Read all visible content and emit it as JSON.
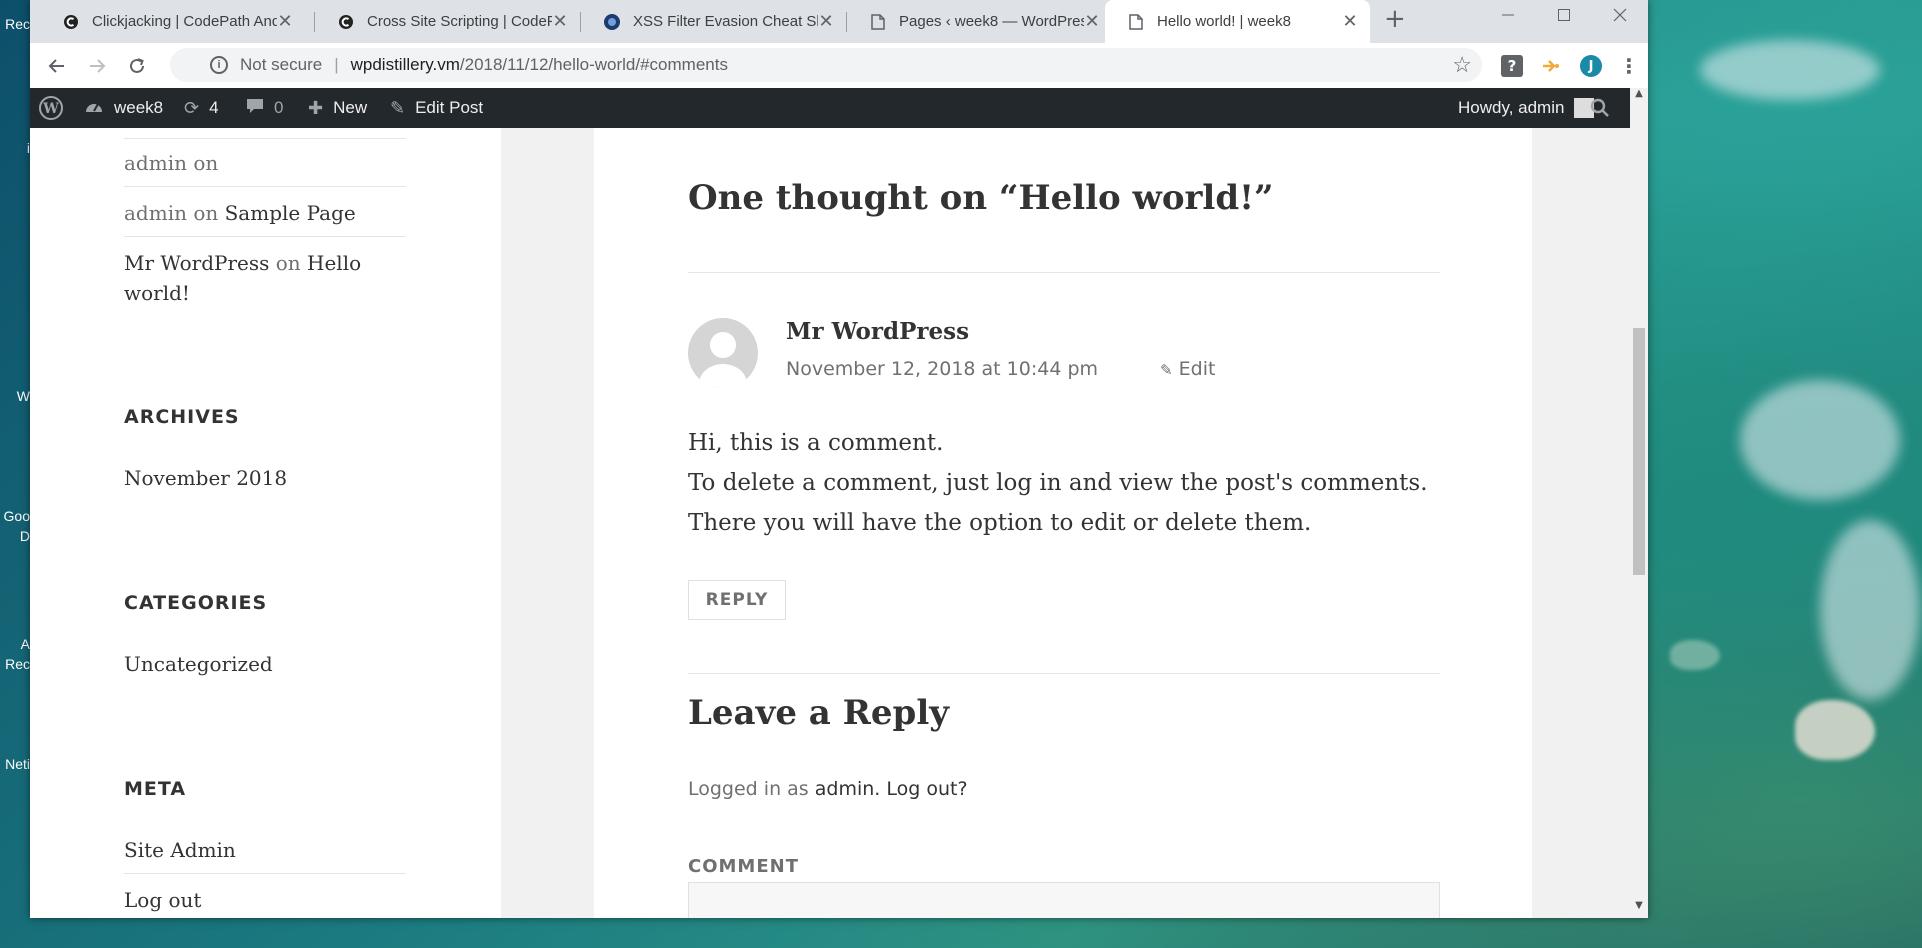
{
  "browser": {
    "tabs": [
      {
        "title": "Clickjacking | CodePath And",
        "icon": "codepath-icon"
      },
      {
        "title": "Cross Site Scripting | CodePa",
        "icon": "codepath-icon"
      },
      {
        "title": "XSS Filter Evasion Cheat She",
        "icon": "owasp-icon"
      },
      {
        "title": "Pages ‹ week8 — WordPress",
        "icon": "page-icon"
      },
      {
        "title": "Hello world! | week8",
        "icon": "page-icon",
        "active": true
      }
    ],
    "close_glyph": "✕",
    "new_tab_glyph": "+",
    "address": {
      "security_label": "Not secure",
      "separator": "|",
      "host": "wpdistillery.vm",
      "path": "/2018/11/12/hello-world/#comments"
    },
    "profile_initial": "J"
  },
  "adminbar": {
    "site_name": "week8",
    "updates_count": "4",
    "comments_count": "0",
    "new_label": "New",
    "edit_post_label": "Edit Post",
    "howdy_label": "Howdy, admin"
  },
  "sidebar": {
    "recent_comments": [
      {
        "author": "admin",
        "on": "on",
        "post": ""
      },
      {
        "author": "admin",
        "on": "on",
        "post": "Sample Page"
      },
      {
        "author": "Mr WordPress",
        "on": "on",
        "post": "Hello",
        "post_cont": "world!"
      }
    ],
    "archives_title": "ARCHIVES",
    "archives_link": "November 2018",
    "categories_title": "CATEGORIES",
    "categories_link": "Uncategorized",
    "meta_title": "META",
    "meta_links": [
      "Site Admin",
      "Log out"
    ]
  },
  "comments": {
    "title": "One thought on “Hello world!”",
    "author": "Mr WordPress",
    "date": "November 12, 2018 at 10:44 pm",
    "edit_label": "Edit",
    "lines": [
      "Hi, this is a comment.",
      "To delete a comment, just log in and view the post's comments.",
      "There you will have the option to edit or delete them."
    ],
    "reply_label": "REPLY"
  },
  "reply_form": {
    "title": "Leave a Reply",
    "logged_in_prefix": "Logged in as",
    "logged_in_user": "admin",
    "logout_label": "Log out?",
    "comment_label": "COMMENT"
  },
  "desktop": {
    "icon_labels": [
      "Rec",
      "i",
      "W",
      "Goo",
      "D",
      "A",
      "Rec",
      "Neti"
    ]
  }
}
